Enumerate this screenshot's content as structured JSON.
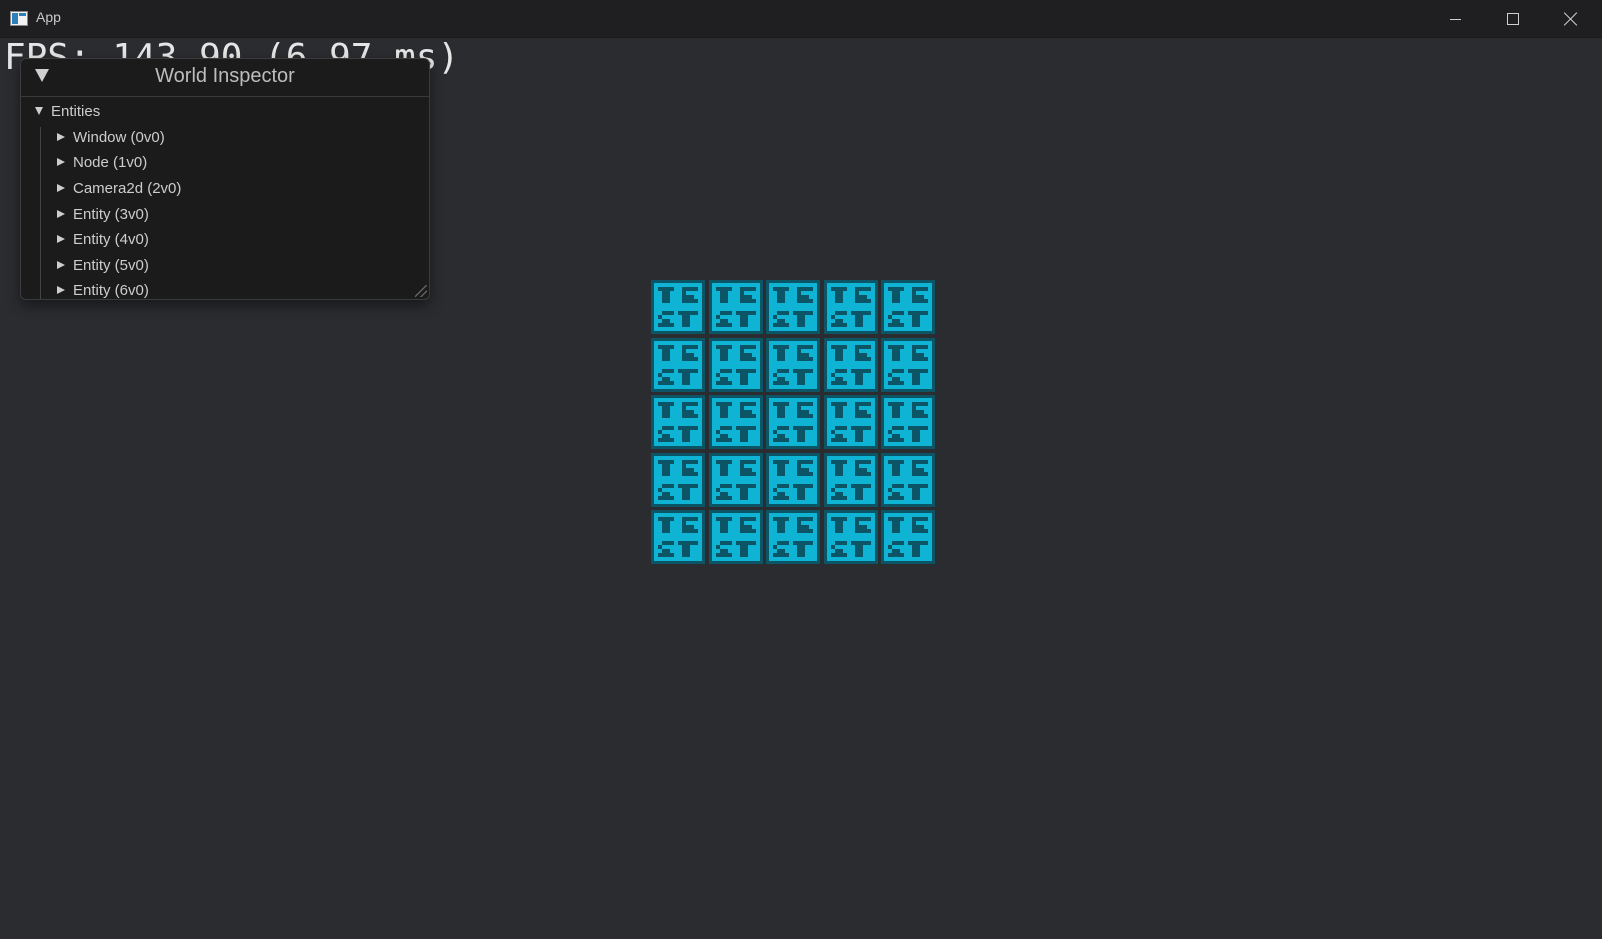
{
  "window": {
    "title": "App",
    "buttons": [
      "minimize",
      "maximize",
      "close"
    ]
  },
  "overlay": {
    "fps_text": "FPS: 143.90 (6.97 ms)"
  },
  "inspector": {
    "title": "World Inspector",
    "section_label": "Entities",
    "items": [
      {
        "label": "Window (0v0)"
      },
      {
        "label": "Node (1v0)"
      },
      {
        "label": "Camera2d (2v0)"
      },
      {
        "label": "Entity (3v0)"
      },
      {
        "label": "Entity (4v0)"
      },
      {
        "label": "Entity (5v0)"
      },
      {
        "label": "Entity (6v0)"
      }
    ]
  },
  "sprites": {
    "rows": 5,
    "cols": 5,
    "tile_text": "TEST",
    "fill_color": "#0fb3d4",
    "border_color": "#0b5567"
  }
}
